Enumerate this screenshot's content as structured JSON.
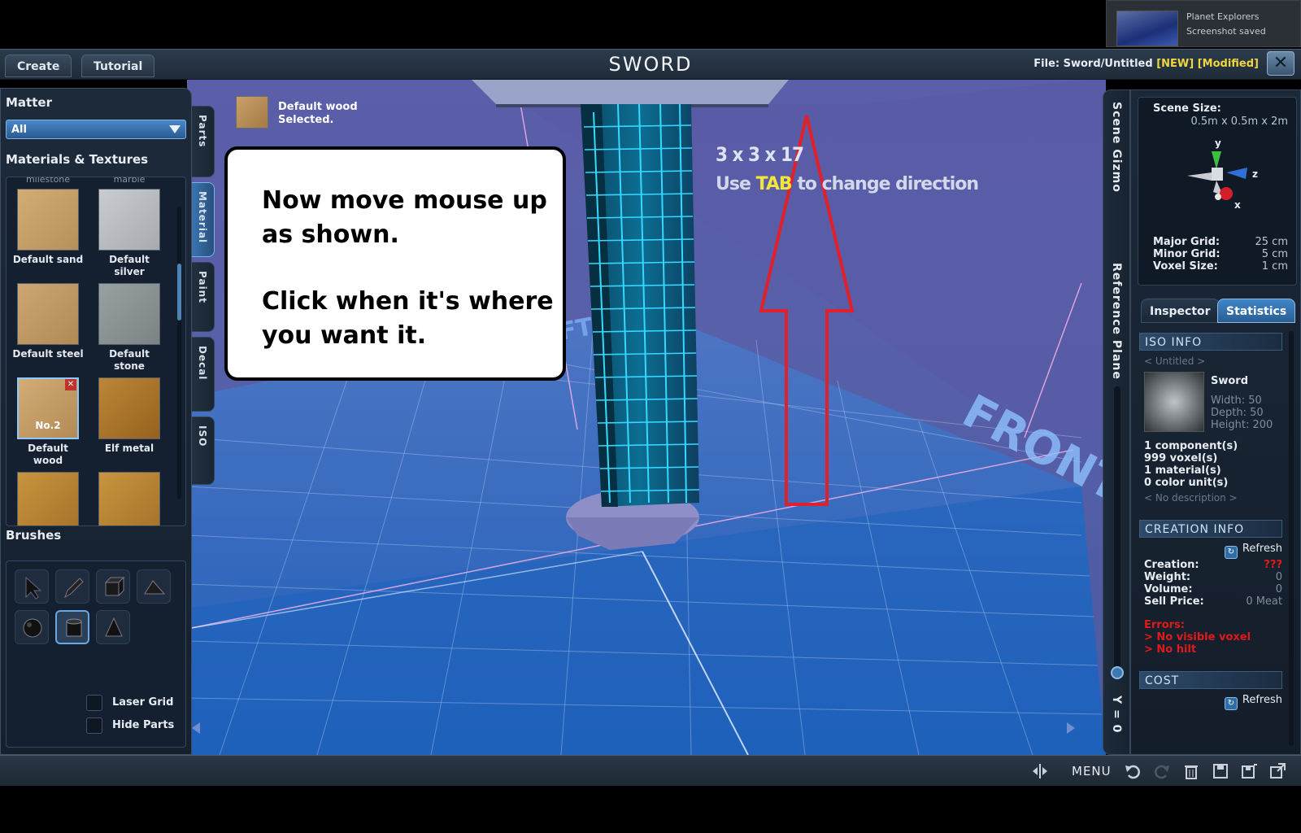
{
  "notification": {
    "app": "Planet Explorers",
    "message": "Screenshot saved"
  },
  "topbar": {
    "create_label": "Create",
    "tutorial_label": "Tutorial",
    "title": "SWORD",
    "file_label": "File:",
    "file_name": "Sword/Untitled",
    "tag_new": "[NEW]",
    "tag_modified": "[Modified]",
    "close_glyph": "✕"
  },
  "left_panel": {
    "matter_heading": "Matter",
    "matter_value": "All",
    "materials_heading": "Materials & Textures",
    "faded_top": [
      "milestone",
      "marble"
    ],
    "materials": [
      {
        "label": "Default sand",
        "color": "#c9a46b"
      },
      {
        "label": "Default silver",
        "color": "#b9bcc0"
      },
      {
        "label": "Default steel",
        "color": "#c4a06a"
      },
      {
        "label": "Default stone",
        "color": "#8d9596"
      },
      {
        "label": "Default wood",
        "color": "#c8a169",
        "badge": "No.2"
      },
      {
        "label": "Elf metal",
        "color": "#b07a2c"
      }
    ],
    "brushes_heading": "Brushes",
    "laser_grid_label": "Laser Grid",
    "hide_parts_label": "Hide Parts"
  },
  "vtabs": {
    "parts": "Parts",
    "material": "Material",
    "paint": "Paint",
    "decal": "Decal",
    "iso": "ISO"
  },
  "selected_material": {
    "line1": "Default wood",
    "line2": "Selected."
  },
  "callout": {
    "line1": "Now move mouse up as shown.",
    "line2": "Click when it's where you want it."
  },
  "overlay": {
    "dims": "3 x 3 x 17",
    "hint_pre": "Use",
    "hint_key": "TAB",
    "hint_post": "to change direction"
  },
  "right_strip": {
    "scene_gizmo": "Scene Gizmo",
    "reference_plane": "Reference Plane",
    "y_readout": "Y = 0"
  },
  "scene": {
    "size_label": "Scene Size:",
    "size_value": "0.5m x 0.5m x 2m",
    "axis_y": "y",
    "axis_z": "z",
    "axis_x": "x",
    "major_grid_label": "Major Grid:",
    "major_grid_value": "25 cm",
    "minor_grid_label": "Minor Grid:",
    "minor_grid_value": "5 cm",
    "voxel_size_label": "Voxel Size:",
    "voxel_size_value": "1 cm"
  },
  "inspector_tabs": {
    "inspector": "Inspector",
    "statistics": "Statistics"
  },
  "iso_info": {
    "heading": "ISO INFO",
    "untitled": "< Untitled >",
    "name": "Sword",
    "width": "Width: 50",
    "depth": "Depth: 50",
    "height": "Height: 200",
    "components": "1 component(s)",
    "voxels": "999 voxel(s)",
    "materials": "1 material(s)",
    "color_units": "0 color unit(s)",
    "no_description": "< No description >"
  },
  "creation_info": {
    "heading": "CREATION INFO",
    "refresh": "Refresh",
    "creation_label": "Creation:",
    "creation_value": "???",
    "weight_label": "Weight:",
    "weight_value": "0",
    "volume_label": "Volume:",
    "volume_value": "0",
    "price_label": "Sell Price:",
    "price_value": "0 Meat",
    "errors_heading": "Errors:",
    "error1": "> No visible voxel",
    "error2": "> No hilt"
  },
  "cost": {
    "heading": "COST",
    "refresh": "Refresh"
  },
  "bottombar": {
    "menu_label": "MENU"
  },
  "colors": {
    "accent": "#3a74b0",
    "warning_yellow": "#f0d640",
    "error_red": "#e01a1a",
    "arrow_red": "#e0202a",
    "grid_cyan": "#35d8ff"
  }
}
